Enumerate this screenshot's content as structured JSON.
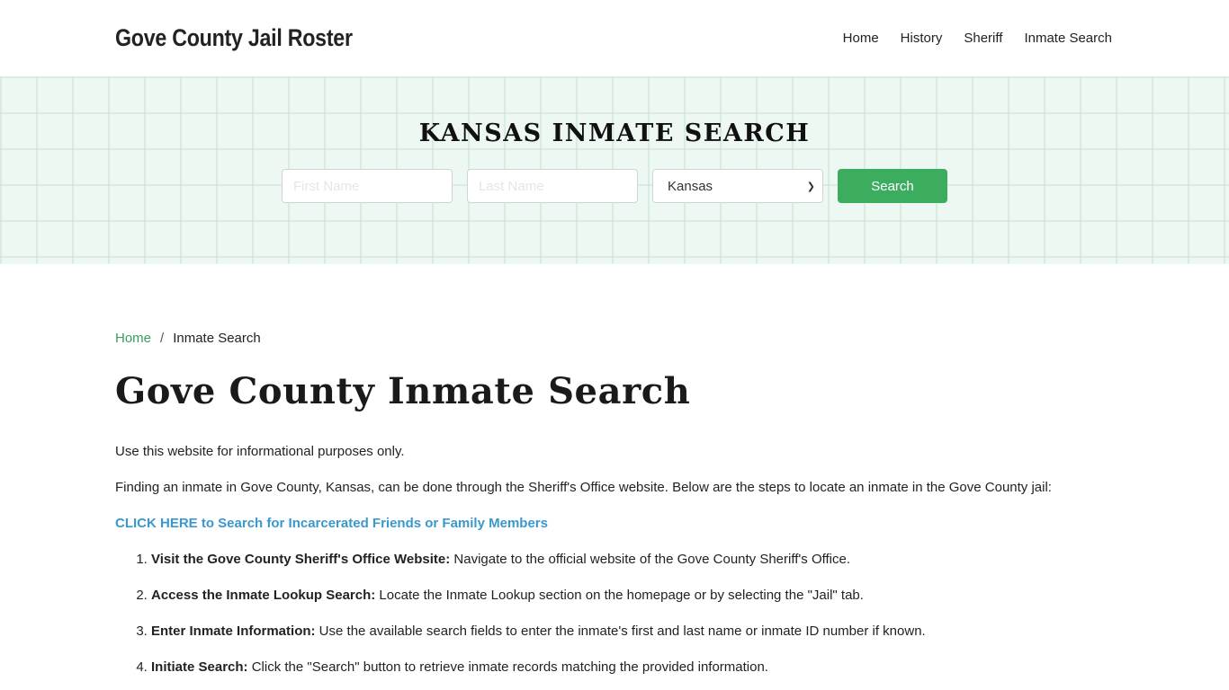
{
  "header": {
    "brand": "Gove County Jail Roster",
    "nav": [
      {
        "label": "Home"
      },
      {
        "label": "History"
      },
      {
        "label": "Sheriff"
      },
      {
        "label": "Inmate Search"
      }
    ]
  },
  "hero": {
    "title": "KANSAS INMATE SEARCH",
    "first_name_placeholder": "First Name",
    "last_name_placeholder": "Last Name",
    "state_selected": "Kansas",
    "search_label": "Search"
  },
  "breadcrumb": {
    "home": "Home",
    "separator": "/",
    "current": "Inmate Search"
  },
  "main": {
    "title": "Gove County Inmate Search",
    "intro": "Use this website for informational purposes only.",
    "description": "Finding an inmate in Gove County, Kansas, can be done through the Sheriff's Office website. Below are the steps to locate an inmate in the Gove County jail:",
    "cta_link": "CLICK HERE to Search for Incarcerated Friends or Family Members",
    "steps": [
      {
        "title": "Visit the Gove County Sheriff's Office Website:",
        "text": " Navigate to the official website of the Gove County Sheriff's Office."
      },
      {
        "title": "Access the Inmate Lookup Search:",
        "text": " Locate the Inmate Lookup section on the homepage or by selecting the \"Jail\" tab."
      },
      {
        "title": "Enter Inmate Information:",
        "text": " Use the available search fields to enter the inmate's first and last name or inmate ID number if known."
      },
      {
        "title": "Initiate Search:",
        "text": " Click the \"Search\" button to retrieve inmate records matching the provided information."
      }
    ]
  },
  "colors": {
    "accent_green": "#3cad5f",
    "link_green": "#3a9b63",
    "link_blue": "#3a98cc",
    "hero_bg": "#eef8f2"
  }
}
